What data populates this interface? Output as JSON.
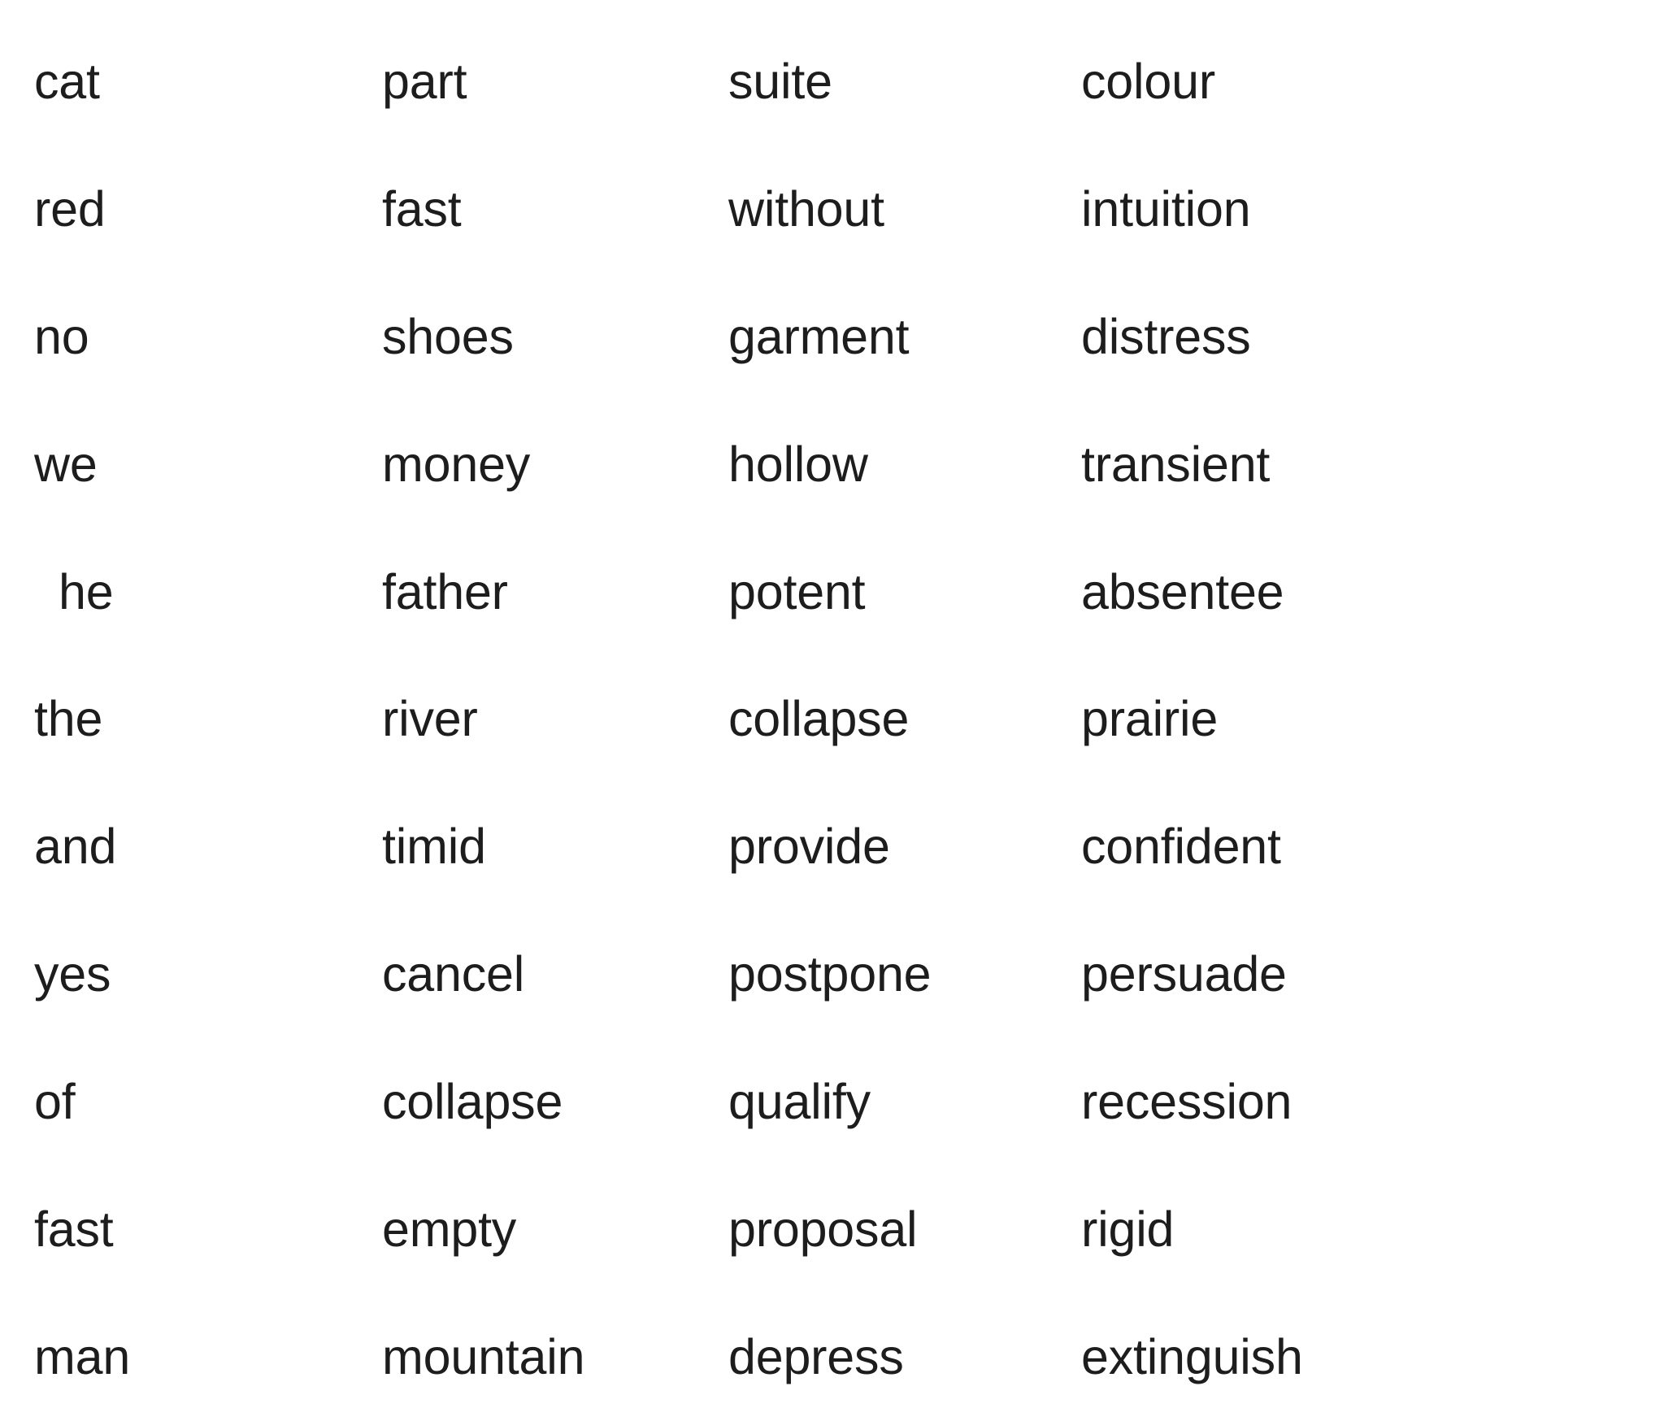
{
  "document": {
    "kind": "word-list",
    "background_color": "#ffffff",
    "text_color": "#1d1d1d",
    "columns": 4,
    "rows": 11
  },
  "word_list": {
    "columns": [
      {
        "index": 1,
        "words": [
          "cat",
          "red",
          "no",
          "we",
          "he",
          "the",
          "and",
          "yes",
          "of",
          "fast",
          "man"
        ]
      },
      {
        "index": 2,
        "words": [
          "part",
          "fast",
          "shoes",
          "money",
          "father",
          "river",
          "timid",
          "cancel",
          "collapse",
          "empty",
          "mountain"
        ]
      },
      {
        "index": 3,
        "words": [
          "suite",
          "without",
          "garment",
          "hollow",
          "potent",
          "collapse",
          "provide",
          "postpone",
          "qualify",
          "proposal",
          "depress"
        ]
      },
      {
        "index": 4,
        "words": [
          "colour",
          "intuition",
          "distress",
          "transient",
          "absentee",
          "prairie",
          "confident",
          "persuade",
          "recession",
          "rigid",
          "extinguish"
        ]
      }
    ],
    "rows": [
      [
        "cat",
        "part",
        "suite",
        "colour"
      ],
      [
        "red",
        "fast",
        "without",
        "intuition"
      ],
      [
        "no",
        "shoes",
        "garment",
        "distress"
      ],
      [
        "we",
        "money",
        "hollow",
        "transient"
      ],
      [
        "he",
        "father",
        "potent",
        "absentee"
      ],
      [
        "the",
        "river",
        "collapse",
        "prairie"
      ],
      [
        "and",
        "timid",
        "provide",
        "confident"
      ],
      [
        "yes",
        "cancel",
        "postpone",
        "persuade"
      ],
      [
        "of",
        "collapse",
        "qualify",
        "recession"
      ],
      [
        "fast",
        "empty",
        "proposal",
        "rigid"
      ],
      [
        "man",
        "mountain",
        "depress",
        "extinguish"
      ]
    ]
  }
}
